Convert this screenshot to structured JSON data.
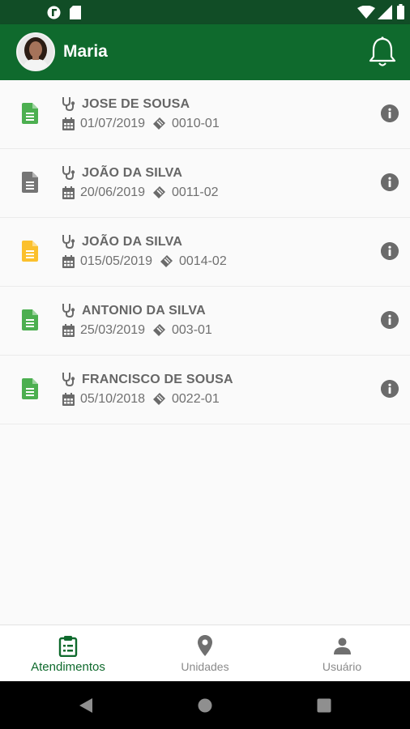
{
  "header": {
    "user_name": "Maria"
  },
  "appointments": [
    {
      "doctor": "JOSE DE SOUSA",
      "date": "01/07/2019",
      "code": "0010-01",
      "doc_color": "#4caf50"
    },
    {
      "doctor": "JOÃO DA SILVA",
      "date": "20/06/2019",
      "code": "0011-02",
      "doc_color": "#757575"
    },
    {
      "doctor": "JOÃO DA SILVA",
      "date": "015/05/2019",
      "code": "0014-02",
      "doc_color": "#fbc02d"
    },
    {
      "doctor": "ANTONIO DA SILVA",
      "date": "25/03/2019",
      "code": "003-01",
      "doc_color": "#4caf50"
    },
    {
      "doctor": "FRANCISCO DE SOUSA",
      "date": "05/10/2018",
      "code": "0022-01",
      "doc_color": "#4caf50"
    }
  ],
  "bottom_nav": [
    {
      "label": "Atendimentos",
      "icon": "clipboard-icon",
      "active": true
    },
    {
      "label": "Unidades",
      "icon": "map-pin-icon",
      "active": false
    },
    {
      "label": "Usuário",
      "icon": "user-icon",
      "active": false
    }
  ],
  "colors": {
    "primary": "#0f6a2d",
    "status_bar": "#114d26"
  }
}
